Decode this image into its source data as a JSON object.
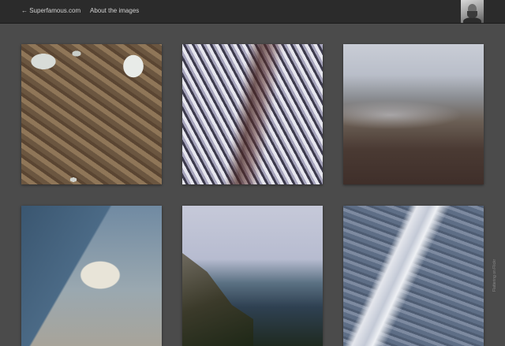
{
  "header": {
    "back_link": "← Superfamous.com",
    "about_link": "About the images"
  },
  "avatar": {
    "icon": "portrait-photo"
  },
  "gallery": {
    "photos": [
      {
        "subject": "aerial-snowy-farmland"
      },
      {
        "subject": "aerial-snow-ridges"
      },
      {
        "subject": "aerial-mountains-haze"
      },
      {
        "subject": "aerial-coast-surf"
      },
      {
        "subject": "coastline-cliffs"
      },
      {
        "subject": "aerial-river-valley"
      }
    ]
  },
  "sidebar": {
    "credit": "Flattering on Flickr"
  },
  "colors": {
    "background": "#4b4b4b",
    "topbar": "#2b2b2b",
    "link": "#d2d2d2"
  }
}
